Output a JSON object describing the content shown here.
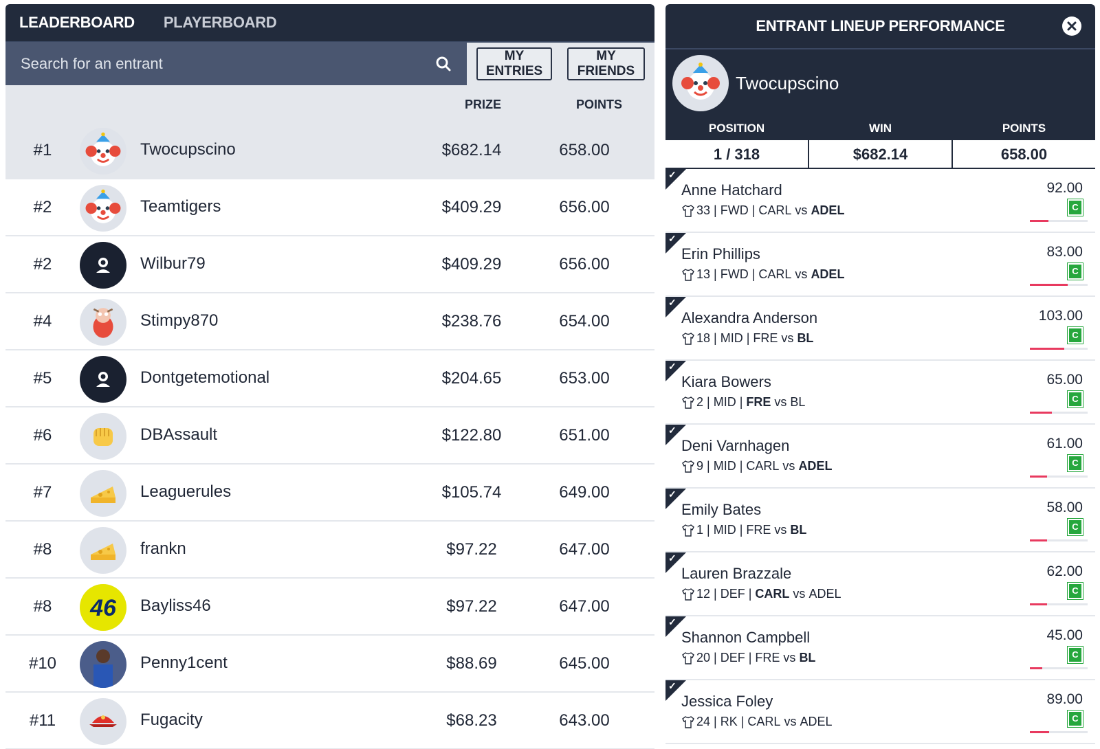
{
  "tabs": {
    "leaderboard": "LEADERBOARD",
    "playerboard": "PLAYERBOARD"
  },
  "search": {
    "placeholder": "Search for an entrant",
    "value": ""
  },
  "filters": {
    "my_entries": "MY ENTRIES",
    "my_friends": "MY FRIENDS"
  },
  "columns": {
    "prize": "PRIZE",
    "points": "POINTS"
  },
  "leaderboard": [
    {
      "rank": "#1",
      "name": "Twocupscino",
      "prize": "$682.14",
      "points": "658.00",
      "avatar": "clown"
    },
    {
      "rank": "#2",
      "name": "Teamtigers",
      "prize": "$409.29",
      "points": "656.00",
      "avatar": "clown"
    },
    {
      "rank": "#2",
      "name": "Wilbur79",
      "prize": "$409.29",
      "points": "656.00",
      "avatar": "default-user"
    },
    {
      "rank": "#4",
      "name": "Stimpy870",
      "prize": "$238.76",
      "points": "654.00",
      "avatar": "cartoon"
    },
    {
      "rank": "#5",
      "name": "Dontgetemotional",
      "prize": "$204.65",
      "points": "653.00",
      "avatar": "default-user"
    },
    {
      "rank": "#6",
      "name": "DBAssault",
      "prize": "$122.80",
      "points": "651.00",
      "avatar": "fist"
    },
    {
      "rank": "#7",
      "name": "Leaguerules",
      "prize": "$105.74",
      "points": "649.00",
      "avatar": "cheese"
    },
    {
      "rank": "#8",
      "name": "frankn",
      "prize": "$97.22",
      "points": "647.00",
      "avatar": "cheese"
    },
    {
      "rank": "#8",
      "name": "Bayliss46",
      "prize": "$97.22",
      "points": "647.00",
      "avatar": "number-46"
    },
    {
      "rank": "#10",
      "name": "Penny1cent",
      "prize": "$88.69",
      "points": "645.00",
      "avatar": "photo"
    },
    {
      "rank": "#11",
      "name": "Fugacity",
      "prize": "$68.23",
      "points": "643.00",
      "avatar": "red-cap"
    }
  ],
  "panel": {
    "title": "ENTRANT LINEUP PERFORMANCE",
    "entrant_name": "Twocupscino",
    "stats": [
      {
        "label": "POSITION",
        "value": "1 / 318"
      },
      {
        "label": "WIN",
        "value": "$682.14"
      },
      {
        "label": "POINTS",
        "value": "658.00"
      }
    ],
    "players": [
      {
        "name": "Anne Hatchard",
        "number": "33",
        "pos": "FWD",
        "home": "CARL",
        "vs": "vs",
        "away": "ADEL",
        "bold_side": "away",
        "score": "92.00",
        "badge": "C",
        "progress": 0.32
      },
      {
        "name": "Erin Phillips",
        "number": "13",
        "pos": "FWD",
        "home": "CARL",
        "vs": "vs",
        "away": "ADEL",
        "bold_side": "away",
        "score": "83.00",
        "badge": "C",
        "progress": 0.66
      },
      {
        "name": "Alexandra Anderson",
        "number": "18",
        "pos": "MID",
        "home": "FRE",
        "vs": "vs",
        "away": "BL",
        "bold_side": "away",
        "score": "103.00",
        "badge": "C",
        "progress": 0.6
      },
      {
        "name": "Kiara Bowers",
        "number": "2",
        "pos": "MID",
        "home": "FRE",
        "vs": "vs",
        "away": "BL",
        "bold_side": "home",
        "score": "65.00",
        "badge": "C",
        "progress": 0.38
      },
      {
        "name": "Deni Varnhagen",
        "number": "9",
        "pos": "MID",
        "home": "CARL",
        "vs": "vs",
        "away": "ADEL",
        "bold_side": "away",
        "score": "61.00",
        "badge": "C",
        "progress": 0.3
      },
      {
        "name": "Emily Bates",
        "number": "1",
        "pos": "MID",
        "home": "FRE",
        "vs": "vs",
        "away": "BL",
        "bold_side": "away",
        "score": "58.00",
        "badge": "C",
        "progress": 0.3
      },
      {
        "name": "Lauren Brazzale",
        "number": "12",
        "pos": "DEF",
        "home": "CARL",
        "vs": "vs",
        "away": "ADEL",
        "bold_side": "home",
        "score": "62.00",
        "badge": "C",
        "progress": 0.3
      },
      {
        "name": "Shannon Campbell",
        "number": "20",
        "pos": "DEF",
        "home": "FRE",
        "vs": "vs",
        "away": "BL",
        "bold_side": "away",
        "score": "45.00",
        "badge": "C",
        "progress": 0.22
      },
      {
        "name": "Jessica Foley",
        "number": "24",
        "pos": "RK",
        "home": "CARL",
        "vs": "vs",
        "away": "ADEL",
        "bold_side": "none",
        "score": "89.00",
        "badge": "C",
        "progress": 0.33
      }
    ]
  },
  "colors": {
    "navy": "#222b3c",
    "search_bg": "#4a5670",
    "row_divider": "#e4e7ec",
    "badge_green": "#26a73d",
    "progress_red": "#e83a5f"
  }
}
